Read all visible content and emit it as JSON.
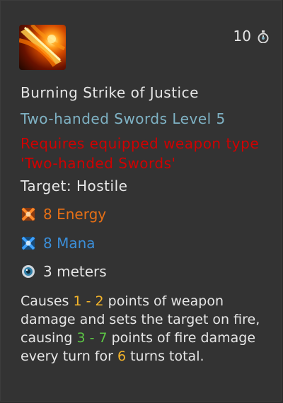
{
  "skill": {
    "name": "Burning Strike of Justice",
    "school_level": "Two-handed Swords Level 5",
    "requirement": "Requires equipped weapon type 'Two-handed Swords'",
    "target": "Target: Hostile",
    "cooldown": "10",
    "icon": "flaming-sword-strike-icon"
  },
  "costs": {
    "energy": "8 Energy",
    "mana": "8 Mana",
    "range": "3 meters"
  },
  "description": {
    "p1": "Causes ",
    "d1": "1 - 2",
    "p2": " points of weapon damage and sets the target on fire, causing ",
    "d2": "3 - 7",
    "p3": " points of fire damage every turn for ",
    "d3": "6",
    "p4": " turns total."
  },
  "colors": {
    "background": "#333333",
    "requirement": "#d10000",
    "school": "#7fb2c4",
    "energy": "#e56f16",
    "mana": "#3b8ed8",
    "value_yellow": "#f5b52a",
    "value_green": "#5cc445"
  }
}
